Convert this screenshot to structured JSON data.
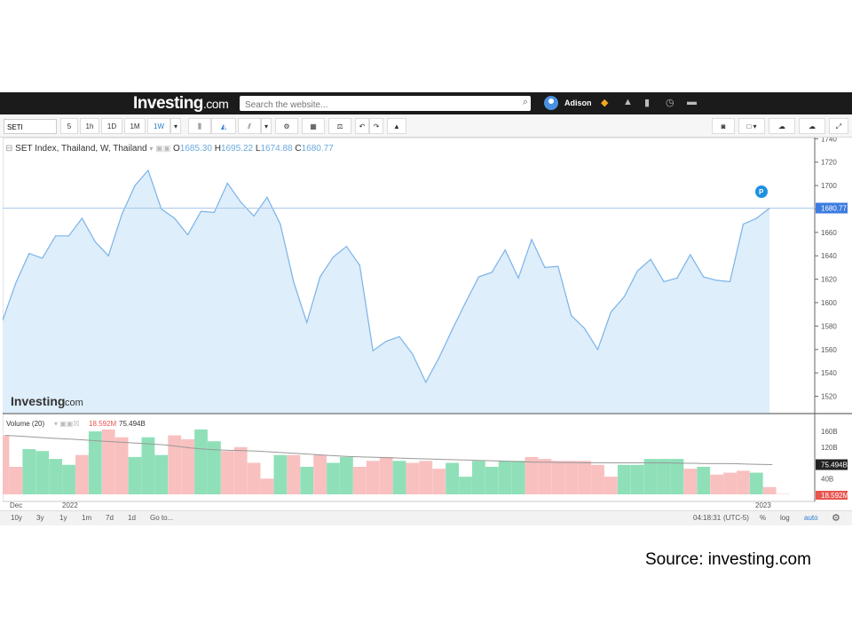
{
  "site": {
    "logo_main": "Investing",
    "logo_suffix": ".com",
    "search_placeholder": "Search the website...",
    "user": "Adison"
  },
  "toolbar": {
    "symbol": "SETI",
    "intervals": [
      "5",
      "1h",
      "1D",
      "1M",
      "1W"
    ],
    "active_interval": "1W"
  },
  "legend": {
    "title": "SET Index, Thailand, W, Thailand",
    "o_label": "O",
    "o": "1685.30",
    "h_label": "H",
    "h": "1695.22",
    "l_label": "L",
    "l": "1674.88",
    "c_label": "C",
    "c": "1680.77",
    "volume_title": "Volume (20)",
    "volume_down": "18.592M",
    "volume_last": "75.494B"
  },
  "colors": {
    "line": "#7ab3e8",
    "area": "#deeefa",
    "up": "#8fe0b8",
    "down": "#f9c0c0",
    "ma": "#999999",
    "last_price_bg": "#3d7ce0"
  },
  "watermark": {
    "main": "Investing",
    "suffix": ".com"
  },
  "badge": "P",
  "bottom": {
    "ranges": [
      "10y",
      "3y",
      "1y",
      "1m",
      "7d",
      "1d",
      "Go to..."
    ],
    "clock": "04:18:31",
    "tz": "(UTC-5)",
    "pct": "%",
    "log": "log",
    "auto": "auto"
  },
  "source": "Source: investing.com",
  "chart_data": {
    "type": "area",
    "title": "SET Index, Thailand, W, Thailand",
    "x_ticks": [
      "Dec",
      "2022",
      "2023"
    ],
    "y_ticks": [
      1520,
      1540,
      1560,
      1580,
      1600,
      1620,
      1640,
      1660,
      1680,
      1700,
      1720,
      1740
    ],
    "ylim": [
      1506,
      1741
    ],
    "last_price": 1680.77,
    "values": [
      1585,
      1617,
      1642,
      1638,
      1657,
      1657,
      1672,
      1652,
      1640,
      1675,
      1700,
      1713,
      1680,
      1672,
      1658,
      1678,
      1677,
      1702,
      1686,
      1674,
      1690,
      1667,
      1618,
      1583,
      1622,
      1639,
      1648,
      1632,
      1559,
      1567,
      1571,
      1556,
      1532,
      1553,
      1577,
      1600,
      1622,
      1626,
      1645,
      1621,
      1654,
      1630,
      1631,
      1589,
      1578,
      1560,
      1592,
      1605,
      1627,
      1637,
      1618,
      1621,
      1641,
      1622,
      1619,
      1618,
      1667,
      1672,
      1680.77
    ],
    "volume": {
      "name": "Volume (20)",
      "y_ticks": [
        "40B",
        "80B",
        "120B",
        "160B"
      ],
      "ylim_billions": [
        0,
        185
      ],
      "bars": [
        {
          "v": 150,
          "d": "down"
        },
        {
          "v": 70,
          "d": "down"
        },
        {
          "v": 115,
          "d": "up"
        },
        {
          "v": 110,
          "d": "up"
        },
        {
          "v": 90,
          "d": "up"
        },
        {
          "v": 75,
          "d": "up"
        },
        {
          "v": 100,
          "d": "down"
        },
        {
          "v": 160,
          "d": "up"
        },
        {
          "v": 165,
          "d": "down"
        },
        {
          "v": 145,
          "d": "down"
        },
        {
          "v": 95,
          "d": "up"
        },
        {
          "v": 145,
          "d": "up"
        },
        {
          "v": 100,
          "d": "up"
        },
        {
          "v": 150,
          "d": "down"
        },
        {
          "v": 140,
          "d": "down"
        },
        {
          "v": 165,
          "d": "up"
        },
        {
          "v": 135,
          "d": "up"
        },
        {
          "v": 110,
          "d": "down"
        },
        {
          "v": 120,
          "d": "down"
        },
        {
          "v": 80,
          "d": "down"
        },
        {
          "v": 40,
          "d": "down"
        },
        {
          "v": 100,
          "d": "up"
        },
        {
          "v": 100,
          "d": "down"
        },
        {
          "v": 70,
          "d": "up"
        },
        {
          "v": 100,
          "d": "down"
        },
        {
          "v": 80,
          "d": "up"
        },
        {
          "v": 95,
          "d": "up"
        },
        {
          "v": 70,
          "d": "down"
        },
        {
          "v": 85,
          "d": "down"
        },
        {
          "v": 95,
          "d": "down"
        },
        {
          "v": 85,
          "d": "up"
        },
        {
          "v": 80,
          "d": "down"
        },
        {
          "v": 85,
          "d": "down"
        },
        {
          "v": 65,
          "d": "down"
        },
        {
          "v": 80,
          "d": "up"
        },
        {
          "v": 45,
          "d": "up"
        },
        {
          "v": 85,
          "d": "up"
        },
        {
          "v": 70,
          "d": "up"
        },
        {
          "v": 85,
          "d": "up"
        },
        {
          "v": 85,
          "d": "up"
        },
        {
          "v": 95,
          "d": "down"
        },
        {
          "v": 90,
          "d": "down"
        },
        {
          "v": 85,
          "d": "down"
        },
        {
          "v": 85,
          "d": "down"
        },
        {
          "v": 85,
          "d": "down"
        },
        {
          "v": 75,
          "d": "down"
        },
        {
          "v": 45,
          "d": "down"
        },
        {
          "v": 75,
          "d": "up"
        },
        {
          "v": 75,
          "d": "up"
        },
        {
          "v": 90,
          "d": "up"
        },
        {
          "v": 90,
          "d": "up"
        },
        {
          "v": 90,
          "d": "up"
        },
        {
          "v": 65,
          "d": "down"
        },
        {
          "v": 70,
          "d": "up"
        },
        {
          "v": 50,
          "d": "down"
        },
        {
          "v": 55,
          "d": "down"
        },
        {
          "v": 60,
          "d": "down"
        },
        {
          "v": 55,
          "d": "up"
        },
        {
          "v": 18.592,
          "d": "down"
        },
        {
          "v": 1,
          "d": "down"
        }
      ],
      "ma": [
        150,
        148,
        146,
        144,
        142,
        140,
        138,
        136,
        134,
        132,
        130,
        128,
        126,
        122,
        118,
        115,
        113,
        112,
        111,
        110,
        108,
        106,
        104,
        102,
        100,
        98,
        96,
        95,
        94,
        93,
        92,
        91,
        90,
        89,
        88,
        87,
        86,
        85,
        84,
        83,
        82,
        82,
        81,
        81,
        80,
        80,
        80,
        80,
        80,
        80,
        80,
        79,
        79,
        78,
        78,
        78,
        77,
        76,
        75.494
      ]
    }
  }
}
